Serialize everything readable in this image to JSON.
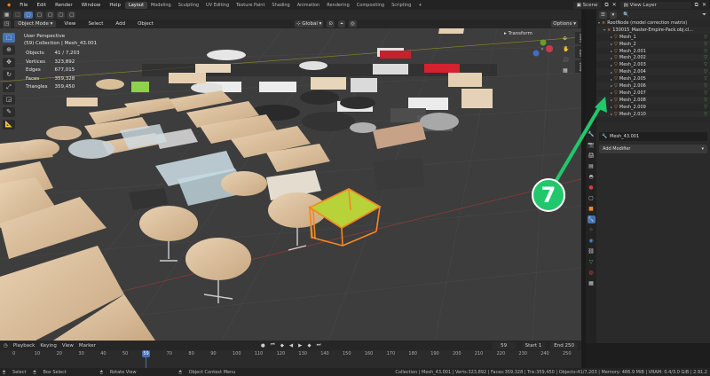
{
  "menubar": {
    "items": [
      "File",
      "Edit",
      "Render",
      "Window",
      "Help"
    ],
    "workspaces": [
      "Layout",
      "Modeling",
      "Sculpting",
      "UV Editing",
      "Texture Paint",
      "Shading",
      "Animation",
      "Rendering",
      "Compositing",
      "Scripting"
    ],
    "active_workspace": "Layout",
    "scene": "Scene",
    "view_layer": "View Layer"
  },
  "viewport_header": {
    "mode": "Object Mode",
    "menus": [
      "View",
      "Select",
      "Add",
      "Object"
    ],
    "orientation": "Global",
    "options": "Options"
  },
  "viewport_overlay": {
    "view_name": "User Perspective",
    "collection": "(59) Collection | Mesh_43.001",
    "stats": [
      {
        "label": "Objects",
        "value": "41 / 7,203"
      },
      {
        "label": "Vertices",
        "value": "323,892"
      },
      {
        "label": "Edges",
        "value": "677,015"
      },
      {
        "label": "Faces",
        "value": "359,328"
      },
      {
        "label": "Triangles",
        "value": "359,450"
      }
    ],
    "transform_label": "Transform"
  },
  "side_tabs": [
    "Item",
    "Tool",
    "View"
  ],
  "outliner": {
    "rows": [
      {
        "label": "RootNode (model correction matrix)",
        "kind": "root",
        "indent": 0
      },
      {
        "label": "130015_Master-Empire-Pack.obj.cl...",
        "kind": "group",
        "indent": 1
      },
      {
        "label": "Mesh_1",
        "kind": "mesh",
        "indent": 2
      },
      {
        "label": "Mesh_2",
        "kind": "mesh",
        "indent": 2
      },
      {
        "label": "Mesh_2.001",
        "kind": "mesh",
        "indent": 2
      },
      {
        "label": "Mesh_2.002",
        "kind": "mesh",
        "indent": 2
      },
      {
        "label": "Mesh_2.003",
        "kind": "mesh",
        "indent": 2
      },
      {
        "label": "Mesh_2.004",
        "kind": "mesh",
        "indent": 2
      },
      {
        "label": "Mesh_2.005",
        "kind": "mesh",
        "indent": 2
      },
      {
        "label": "Mesh_2.006",
        "kind": "mesh",
        "indent": 2
      },
      {
        "label": "Mesh_2.007",
        "kind": "mesh",
        "indent": 2
      },
      {
        "label": "Mesh_2.008",
        "kind": "mesh",
        "indent": 2
      },
      {
        "label": "Mesh_2.009",
        "kind": "mesh",
        "indent": 2
      },
      {
        "label": "Mesh_2.010",
        "kind": "mesh",
        "indent": 2
      }
    ]
  },
  "properties": {
    "object_name": "Mesh_43.001",
    "add_modifier": "Add Modifier"
  },
  "timeline": {
    "menus": [
      "Playback",
      "Keying",
      "View",
      "Marker"
    ],
    "current_frame": "59",
    "start_label": "Start",
    "start": "1",
    "end_label": "End",
    "end": "250",
    "ruler": [
      "0",
      "10",
      "20",
      "30",
      "40",
      "50",
      "60",
      "70",
      "80",
      "90",
      "100",
      "110",
      "120",
      "130",
      "140",
      "150",
      "160",
      "170",
      "180",
      "190",
      "200",
      "210",
      "220",
      "230",
      "240",
      "250"
    ]
  },
  "statusbar": {
    "left": [
      "Select",
      "Box Select",
      "Rotate View",
      "Object Context Menu"
    ],
    "right": "Collection | Mesh_43.001 | Verts:323,892 | Faces:359,328 | Tris:359,450 | Objects:41/7,203 | Memory: 486.9 MiB | VRAM: 0.4/3.0 GiB | 2.91.2"
  },
  "annotation": {
    "label": "7",
    "color": "#22c76c"
  },
  "colors": {
    "accent": "#4772b3",
    "selected_outline": "#f08a24",
    "selected_fill": "#b8d23a"
  }
}
